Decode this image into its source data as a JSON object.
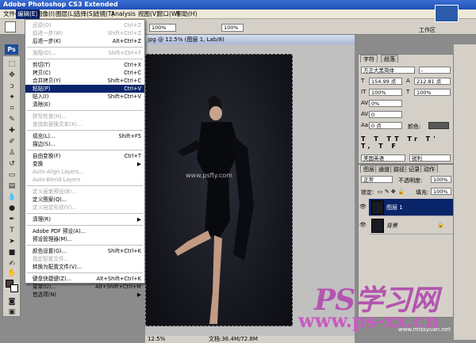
{
  "window_title": "Adobe Photoshop CS3 Extended",
  "menubar": [
    "文件(F)",
    "编辑(E)",
    "图像(I)",
    "图层(L)",
    "选择(S)",
    "滤镜(T)",
    "Analysis",
    "视图(V)",
    "窗口(W)",
    "帮助(H)"
  ],
  "options": {
    "zoom1": "100%",
    "zoom2": "100%",
    "right_label": "工作区"
  },
  "document": {
    "title": "jpg @ 12.5% (图层 1, Lab/8)",
    "zoom": "12.5%",
    "size": "文档:36.4M/72.8M",
    "watermark": "www.psfly.com"
  },
  "edit_menu": [
    {
      "label": "还原(O)",
      "shortcut": "Ctrl+Z",
      "disabled": true
    },
    {
      "label": "前进一步(W)",
      "shortcut": "Shift+Ctrl+Z",
      "disabled": true
    },
    {
      "label": "后退一步(K)",
      "shortcut": "Alt+Ctrl+Z",
      "disabled": false
    },
    {
      "sep": true
    },
    {
      "label": "渐隐(D)...",
      "shortcut": "Shift+Ctrl+F",
      "disabled": true
    },
    {
      "sep": true
    },
    {
      "label": "剪切(T)",
      "shortcut": "Ctrl+X",
      "disabled": false
    },
    {
      "label": "拷贝(C)",
      "shortcut": "Ctrl+C",
      "disabled": false
    },
    {
      "label": "合并拷贝(Y)",
      "shortcut": "Shift+Ctrl+C",
      "disabled": false
    },
    {
      "label": "粘贴(P)",
      "shortcut": "Ctrl+V",
      "disabled": false,
      "highlight": true
    },
    {
      "label": "贴入(I)",
      "shortcut": "Shift+Ctrl+V",
      "disabled": false
    },
    {
      "label": "清除(E)",
      "shortcut": "",
      "disabled": false
    },
    {
      "sep": true
    },
    {
      "label": "拼写检查(H)...",
      "shortcut": "",
      "disabled": true
    },
    {
      "label": "查找和替换文本(X)...",
      "shortcut": "",
      "disabled": true
    },
    {
      "sep": true
    },
    {
      "label": "填充(L)...",
      "shortcut": "Shift+F5",
      "disabled": false
    },
    {
      "label": "描边(S)...",
      "shortcut": "",
      "disabled": false
    },
    {
      "sep": true
    },
    {
      "label": "自由变换(F)",
      "shortcut": "Ctrl+T",
      "disabled": false
    },
    {
      "label": "变换",
      "shortcut": "",
      "disabled": false,
      "arrow": true
    },
    {
      "label": "Auto-Align Layers...",
      "shortcut": "",
      "disabled": true
    },
    {
      "label": "Auto-Blend Layers",
      "shortcut": "",
      "disabled": true
    },
    {
      "sep": true
    },
    {
      "label": "定义画笔预设(B)...",
      "shortcut": "",
      "disabled": true
    },
    {
      "label": "定义图案(Q)...",
      "shortcut": "",
      "disabled": false
    },
    {
      "label": "定义自定形状(V)...",
      "shortcut": "",
      "disabled": true
    },
    {
      "sep": true
    },
    {
      "label": "清理(R)",
      "shortcut": "",
      "disabled": false,
      "arrow": true
    },
    {
      "sep": true
    },
    {
      "label": "Adobe PDF 预设(A)...",
      "shortcut": "",
      "disabled": false
    },
    {
      "label": "预设管理器(M)...",
      "shortcut": "",
      "disabled": false
    },
    {
      "sep": true
    },
    {
      "label": "颜色设置(G)...",
      "shortcut": "Shift+Ctrl+K",
      "disabled": false
    },
    {
      "label": "指定配置文件...",
      "shortcut": "",
      "disabled": true
    },
    {
      "label": "转换为配置文件(V)...",
      "shortcut": "",
      "disabled": false
    },
    {
      "sep": true
    },
    {
      "label": "键盘快捷键(Z)...",
      "shortcut": "Alt+Shift+Ctrl+K",
      "disabled": false
    },
    {
      "label": "菜单(U)...",
      "shortcut": "Alt+Shift+Ctrl+M",
      "disabled": false
    },
    {
      "label": "首选项(N)",
      "shortcut": "",
      "disabled": false,
      "arrow": true
    }
  ],
  "character_panel": {
    "tabs": [
      "字符",
      "段落"
    ],
    "font": "方正大黑简体",
    "font_style": "-",
    "size": "154.99 点",
    "leading": "212.81 点",
    "vscale": "100%",
    "hscale": "100%",
    "tracking": "0%",
    "kerning": "0",
    "baseline": "0 点",
    "color_label": "颜色:",
    "language": "美国英语",
    "aa": "锐利"
  },
  "layers_panel": {
    "tabs": [
      "图层",
      "通道",
      "路径",
      "记录",
      "动作"
    ],
    "blend": "正常",
    "opacity_label": "不透明度:",
    "opacity": "100%",
    "lock_label": "锁定:",
    "fill_label": "填充:",
    "fill": "100%",
    "layers": [
      {
        "name": "图层 1",
        "selected": true
      },
      {
        "name": "背景",
        "selected": false
      }
    ]
  },
  "watermarks": {
    "ps_logo_text": "PS学习网",
    "url_text": "www.ps-xx.cn",
    "small": "www.missyuan.net"
  }
}
